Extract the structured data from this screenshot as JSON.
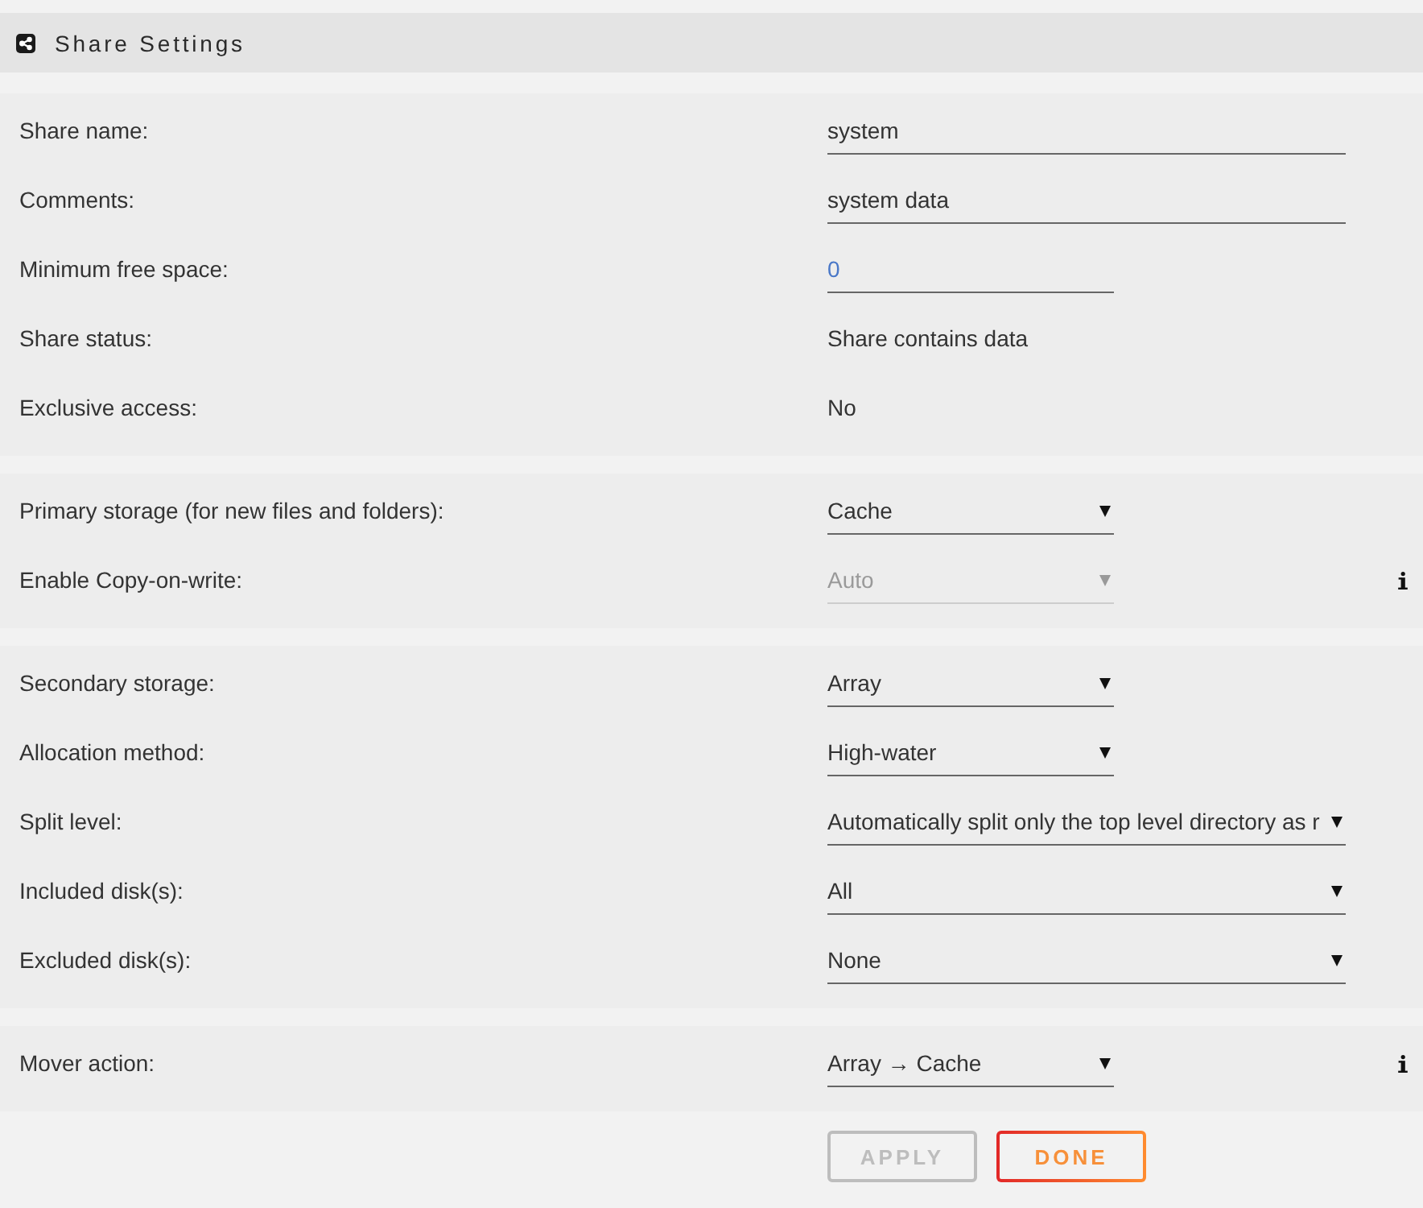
{
  "header": {
    "title": "Share Settings"
  },
  "sections": [
    {
      "rows": [
        {
          "label": "Share name:",
          "field": {
            "kind": "text",
            "value": "system",
            "disabled": false
          },
          "help": false
        },
        {
          "label": "Comments:",
          "field": {
            "kind": "text",
            "value": "system data",
            "disabled": false
          },
          "help": false
        },
        {
          "label": "Minimum free space:",
          "field": {
            "kind": "number",
            "value": "0",
            "disabled": false
          },
          "help": false
        },
        {
          "label": "Share status:",
          "field": {
            "kind": "static",
            "value": "Share contains data"
          },
          "help": false
        },
        {
          "label": "Exclusive access:",
          "field": {
            "kind": "static",
            "value": "No"
          },
          "help": false
        }
      ]
    },
    {
      "rows": [
        {
          "label": "Primary storage (for new files and folders):",
          "field": {
            "kind": "select",
            "value": "Cache",
            "disabled": false
          },
          "help": false
        },
        {
          "label": "Enable Copy-on-write:",
          "field": {
            "kind": "select",
            "value": "Auto",
            "disabled": true
          },
          "help": true
        }
      ]
    },
    {
      "rows": [
        {
          "label": "Secondary storage:",
          "field": {
            "kind": "select",
            "value": "Array",
            "disabled": false
          },
          "help": false
        },
        {
          "label": "Allocation method:",
          "field": {
            "kind": "select",
            "value": "High-water",
            "disabled": false
          },
          "help": false
        },
        {
          "label": "Split level:",
          "field": {
            "kind": "long-select",
            "value": "Automatically split only the top level directory as r",
            "disabled": false
          },
          "help": false
        },
        {
          "label": "Included disk(s):",
          "field": {
            "kind": "long-select",
            "value": "All",
            "disabled": false
          },
          "help": false
        },
        {
          "label": "Excluded disk(s):",
          "field": {
            "kind": "long-select",
            "value": "None",
            "disabled": false
          },
          "help": false
        }
      ]
    },
    {
      "rows": [
        {
          "label": "Mover action:",
          "field": {
            "kind": "select",
            "value": "Array → Cache",
            "disabled": false
          },
          "help": true
        }
      ]
    }
  ],
  "buttons": [
    {
      "label": "APPLY",
      "kind": "apply",
      "disabled": true
    },
    {
      "label": "DONE",
      "kind": "done",
      "disabled": false
    }
  ]
}
